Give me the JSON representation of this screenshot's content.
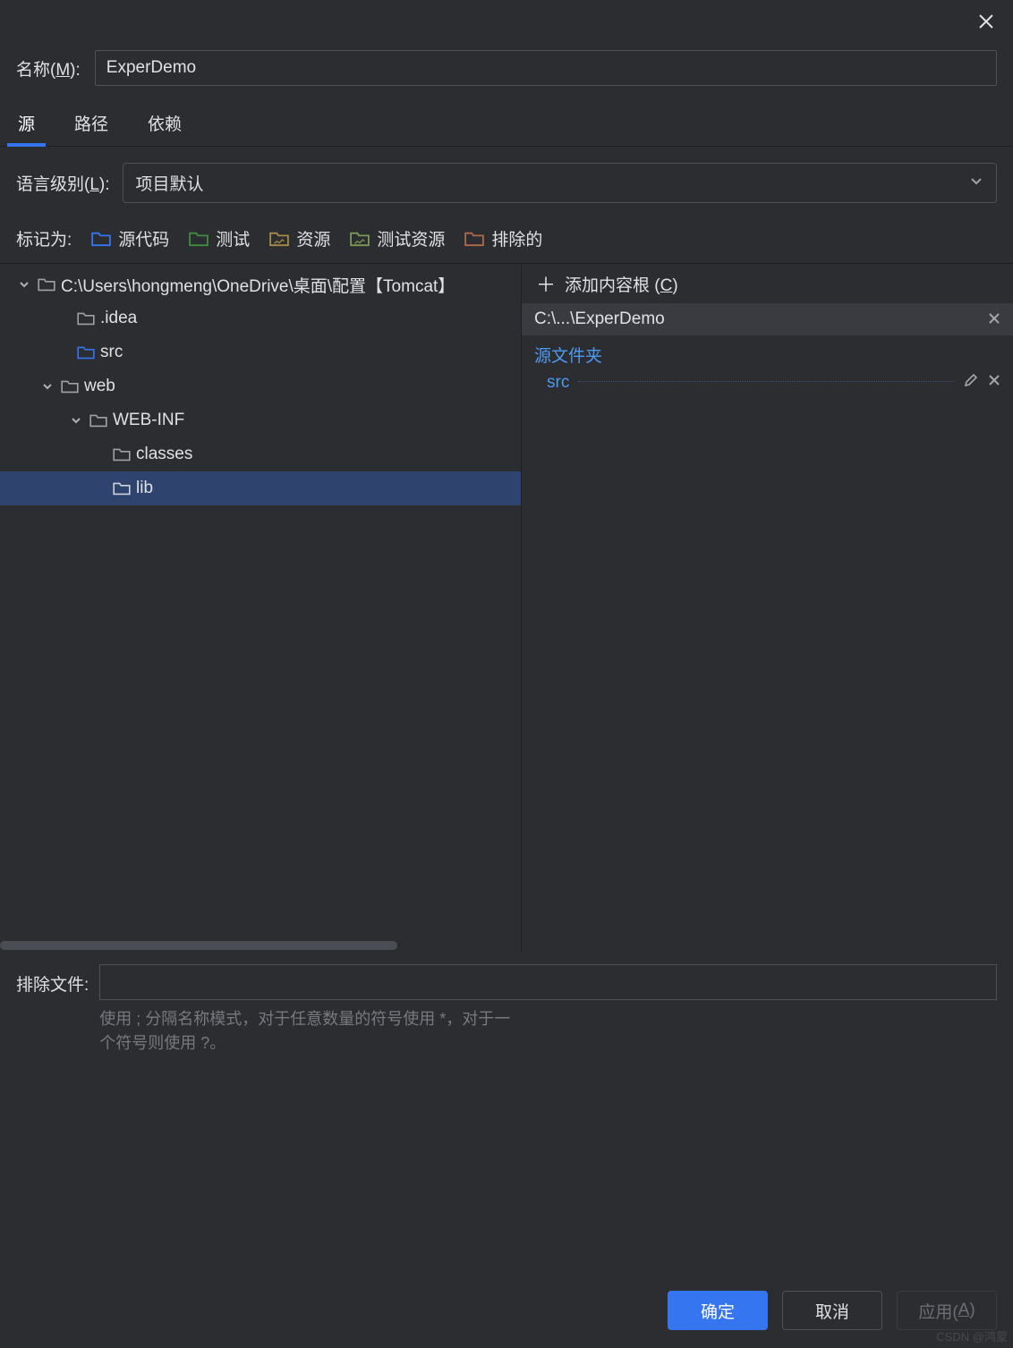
{
  "name_label_pre": "名称(",
  "name_label_u": "M",
  "name_label_post": "):",
  "name_value": "ExperDemo",
  "tabs": {
    "source": "源",
    "path": "路径",
    "deps": "依赖"
  },
  "lang_label_pre": "语言级别(",
  "lang_label_u": "L",
  "lang_label_post": "):",
  "lang_value": "项目默认",
  "mark_label": "标记为:",
  "marks": {
    "sources": "源代码",
    "tests": "测试",
    "resources": "资源",
    "test_resources": "测试资源",
    "excluded": "排除的"
  },
  "tree": {
    "root": "C:\\Users\\hongmeng\\OneDrive\\桌面\\配置【Tomcat】",
    "idea": ".idea",
    "src": "src",
    "web": "web",
    "webinf": "WEB-INF",
    "classes": "classes",
    "lib": "lib"
  },
  "add_root_pre": "添加内容根 (",
  "add_root_u": "C",
  "add_root_post": ")",
  "content_root": "C:\\...\\ExperDemo",
  "source_folders": "源文件夹",
  "source_item": "src",
  "exclude_label": "排除文件:",
  "exclude_help": "使用 ; 分隔名称模式，对于任意数量的符号使用 *，对于一个符号则使用 ?。",
  "buttons": {
    "ok": "确定",
    "cancel": "取消",
    "apply_pre": "应用(",
    "apply_u": "A",
    "apply_post": ")"
  },
  "watermark": "CSDN @鸿蒙",
  "colors": {
    "sources": "#3675f0",
    "tests": "#3f8e3f",
    "resources": "#a88b46",
    "test_resources": "#7a9b55",
    "excluded": "#b1694c",
    "folder": "#9ea2a9"
  }
}
